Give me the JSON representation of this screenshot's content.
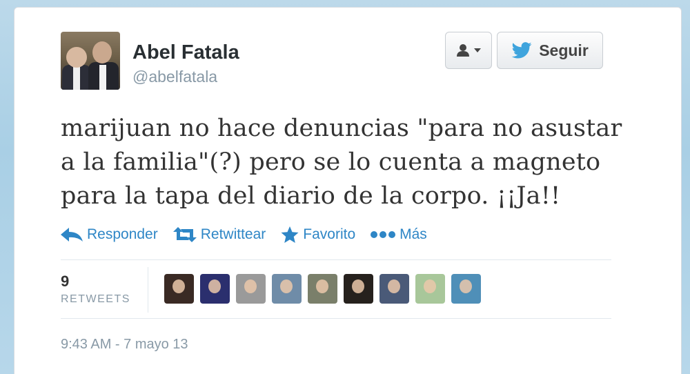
{
  "user": {
    "name": "Abel Fatala",
    "handle": "@abelfatala"
  },
  "buttons": {
    "follow_label": "Seguir"
  },
  "tweet": {
    "lines": [
      "marijuan no hace denuncias \"para no asustar",
      "a la familia\"(?) pero se lo cuenta a magneto",
      "para la tapa del diario de la corpo. ¡¡Ja!!"
    ],
    "timestamp": "9:43 AM - 7 mayo 13"
  },
  "actions": {
    "reply": "Responder",
    "retweet": "Retwittear",
    "favorite": "Favorito",
    "more": "Más"
  },
  "stats": {
    "retweet_count": "9",
    "retweet_label": "RETWEETS"
  },
  "retweeters": [
    {
      "color": "#3a2a24"
    },
    {
      "color": "#2b2f6e"
    },
    {
      "color": "#9a9a9a"
    },
    {
      "color": "#6f8ca8"
    },
    {
      "color": "#7a7f6a"
    },
    {
      "color": "#26211d"
    },
    {
      "color": "#4a5a78"
    },
    {
      "color": "#a8c79a"
    },
    {
      "color": "#4f8fb8"
    }
  ],
  "colors": {
    "link": "#2e86c6",
    "twitter_bird": "#3fa4dd"
  }
}
